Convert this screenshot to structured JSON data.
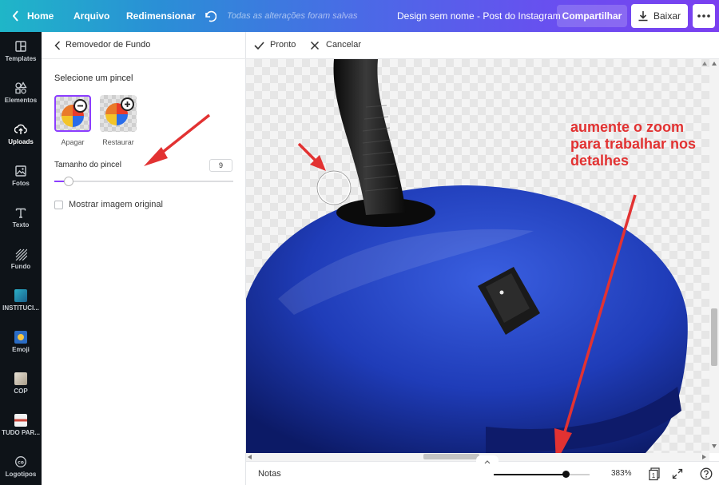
{
  "topbar": {
    "home": "Home",
    "file": "Arquivo",
    "resize": "Redimensionar",
    "saved_status": "Todas as alterações foram salvas",
    "design_title": "Design sem nome - Post do Instagram",
    "share": "Compartilhar",
    "download": "Baixar"
  },
  "sidebar": {
    "items": [
      {
        "label": "Templates",
        "icon": "templates-icon"
      },
      {
        "label": "Elementos",
        "icon": "elements-icon"
      },
      {
        "label": "Uploads",
        "icon": "upload-icon"
      },
      {
        "label": "Fotos",
        "icon": "photos-icon"
      },
      {
        "label": "Texto",
        "icon": "text-icon"
      },
      {
        "label": "Fundo",
        "icon": "background-icon"
      },
      {
        "label": "INSTITUCI...",
        "icon": "folder-thumb-icon"
      },
      {
        "label": "Emoji",
        "icon": "emoji-icon"
      },
      {
        "label": "COP",
        "icon": "folder-thumb-icon"
      },
      {
        "label": "TUDO PAR...",
        "icon": "folder-thumb-icon"
      },
      {
        "label": "Logotipos",
        "icon": "logos-icon"
      }
    ],
    "active": "Uploads"
  },
  "panel": {
    "title": "Removedor de Fundo",
    "brush_heading": "Selecione um pincel",
    "brush_erase": "Apagar",
    "brush_restore": "Restaurar",
    "brush_size_label": "Tamanho do pincel",
    "brush_size_value": "9",
    "brush_size_fraction": 0.08,
    "show_original_label": "Mostrar imagem original",
    "show_original_checked": false
  },
  "editor": {
    "done": "Pronto",
    "cancel": "Cancelar",
    "annotation": "aumente o zoom para trabalhar nos detalhes"
  },
  "bottombar": {
    "notes": "Notas",
    "zoom_level": "383%",
    "zoom_fraction": 0.75,
    "page_count": "1"
  },
  "colors": {
    "accent": "#8b3dff",
    "annotation": "#e23232",
    "lamp_blue": "#1e37b0"
  }
}
